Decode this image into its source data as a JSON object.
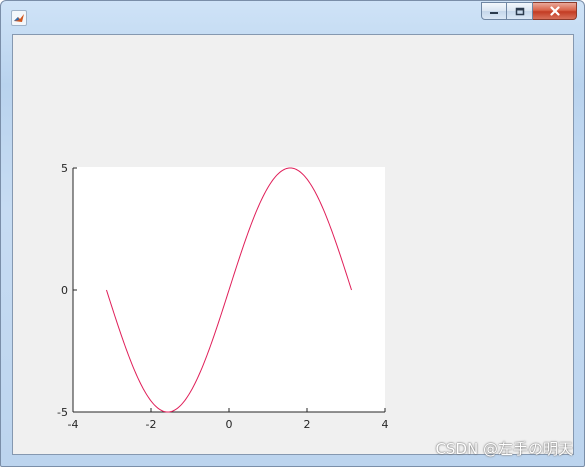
{
  "window": {
    "title": "",
    "icon": "matlab-logo-icon",
    "controls": [
      "minimize-icon",
      "restore-icon",
      "close-icon"
    ],
    "close_color": "#c83c24"
  },
  "figure": {
    "background": "#f0f0f0",
    "axes_background": "#ffffff"
  },
  "chart_data": {
    "type": "line",
    "title": "",
    "xlabel": "",
    "ylabel": "",
    "xlim": [
      -4,
      4
    ],
    "ylim": [
      -5,
      5
    ],
    "xticks": [
      -4,
      -2,
      0,
      2,
      4
    ],
    "yticks": [
      -5,
      0,
      5
    ],
    "xtick_labels": [
      "-4",
      "-2",
      "0",
      "2",
      "4"
    ],
    "ytick_labels": [
      "-5",
      "0",
      "5"
    ],
    "grid": false,
    "series": [
      {
        "color": "#e0205a",
        "x": [
          -3.1416,
          -2.7489,
          -2.3562,
          -1.9635,
          -1.5708,
          -1.1781,
          -0.7854,
          -0.3927,
          0.0,
          0.3927,
          0.7854,
          1.1781,
          1.5708,
          1.9635,
          2.3562,
          2.7489,
          3.1416
        ],
        "y": [
          0.0,
          -1.913,
          -3.536,
          -4.619,
          -5.0,
          -4.619,
          -3.536,
          -1.913,
          0.0,
          1.913,
          3.536,
          4.619,
          5.0,
          4.619,
          3.536,
          1.913,
          0.0
        ]
      }
    ]
  },
  "watermark": "CSDN @左手の明天"
}
